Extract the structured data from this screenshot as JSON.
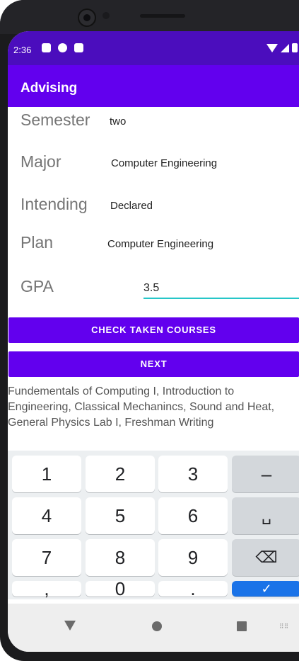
{
  "status": {
    "time": "2:36",
    "left_icons": [
      "notification-a-icon",
      "notification-b-icon",
      "sd-card-icon"
    ],
    "right_icons": [
      "wifi-icon",
      "signal-icon",
      "battery-icon"
    ]
  },
  "appbar": {
    "title": "Advising"
  },
  "fields": [
    {
      "label": "Semester",
      "value": "two"
    },
    {
      "label": "Major",
      "value": "Computer Engineering"
    },
    {
      "label": "Intending",
      "value": "Declared"
    },
    {
      "label": "Plan",
      "value": "Computer Engineering"
    }
  ],
  "gpa": {
    "label": "GPA",
    "value": "3.5"
  },
  "buttons": {
    "check": "CHECK TAKEN COURSES",
    "next": "NEXT"
  },
  "courses_text": "Fundementals of Computing I, Introduction to Engineering, Classical Mechanincs, Sound and Heat, General Physics Lab I, Freshman Writing",
  "keyboard": {
    "rows": [
      [
        "1",
        "2",
        "3",
        "–"
      ],
      [
        "4",
        "5",
        "6",
        "␣"
      ],
      [
        "7",
        "8",
        "9",
        "⌫"
      ],
      [
        ",",
        "0",
        ".",
        "✓"
      ]
    ]
  },
  "colors": {
    "statusbar": "#4b0dbd",
    "appbar": "#6200ee",
    "accent": "#26c6c8",
    "enter": "#1a73e8"
  }
}
